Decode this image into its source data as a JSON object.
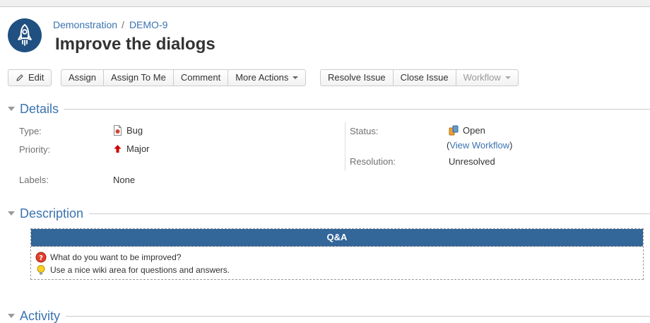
{
  "breadcrumb": {
    "project": "Demonstration",
    "separator": "/",
    "issue_key": "DEMO-9"
  },
  "issue": {
    "title": "Improve the dialogs"
  },
  "toolbar": {
    "edit": "Edit",
    "assign": "Assign",
    "assign_to_me": "Assign To Me",
    "comment": "Comment",
    "more_actions": "More Actions",
    "resolve_issue": "Resolve Issue",
    "close_issue": "Close Issue",
    "workflow": "Workflow"
  },
  "details": {
    "heading": "Details",
    "type": {
      "label": "Type:",
      "value": "Bug",
      "icon": "bug-icon"
    },
    "priority": {
      "label": "Priority:",
      "value": "Major",
      "icon": "priority-major-icon"
    },
    "labels": {
      "label": "Labels:",
      "value": "None"
    },
    "status": {
      "label": "Status:",
      "value": "Open",
      "icon": "status-open-icon"
    },
    "view_workflow": {
      "open": "(",
      "link": "View Workflow",
      "close": ")"
    },
    "resolution": {
      "label": "Resolution:",
      "value": "Unresolved"
    }
  },
  "description": {
    "heading": "Description",
    "panel_title": "Q&A",
    "question": "What do you want to be improved?",
    "answer": "Use a nice wiki area for questions and answers.",
    "question_icon": "question-icon",
    "answer_icon": "lightbulb-icon"
  },
  "activity": {
    "heading": "Activity"
  },
  "colors": {
    "link": "#3b73af",
    "panel_header": "#336699",
    "avatar": "#205081"
  }
}
